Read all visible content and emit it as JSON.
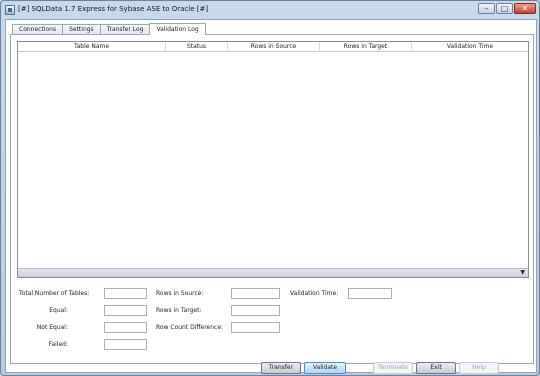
{
  "window": {
    "title": "[#] SQLData 1.7 Express for Sybase ASE to Oracle [#]",
    "controls": {
      "minimize": "–",
      "maximize": "□",
      "close": "✕"
    }
  },
  "tabs": [
    {
      "label": "Connections",
      "active": false
    },
    {
      "label": "Settings",
      "active": false
    },
    {
      "label": "Transfer Log",
      "active": false
    },
    {
      "label": "Validation Log",
      "active": true
    }
  ],
  "grid": {
    "columns": [
      "Table Name",
      "Status",
      "Rows in Source",
      "Rows in Target",
      "Validation Time"
    ],
    "rows": [],
    "scroll_arrow": "▼"
  },
  "stats": {
    "total_tables_label": "Total Number of Tables:",
    "equal_label": "Equal:",
    "not_equal_label": "Not Equal:",
    "failed_label": "Failed:",
    "rows_source_label": "Rows in Source:",
    "rows_target_label": "Rows in Target:",
    "row_diff_label": "Row Count Difference:",
    "validation_time_label": "Validation Time:",
    "total_tables": "",
    "equal": "",
    "not_equal": "",
    "failed": "",
    "rows_source": "",
    "rows_target": "",
    "row_diff": "",
    "validation_time": ""
  },
  "buttons": {
    "transfer": "Transfer",
    "validate": "Validate",
    "terminate": "Terminate",
    "exit": "Exit",
    "help": "Help"
  },
  "colors": {
    "accent": "#4a8bd4",
    "close_button": "#c7452c"
  }
}
